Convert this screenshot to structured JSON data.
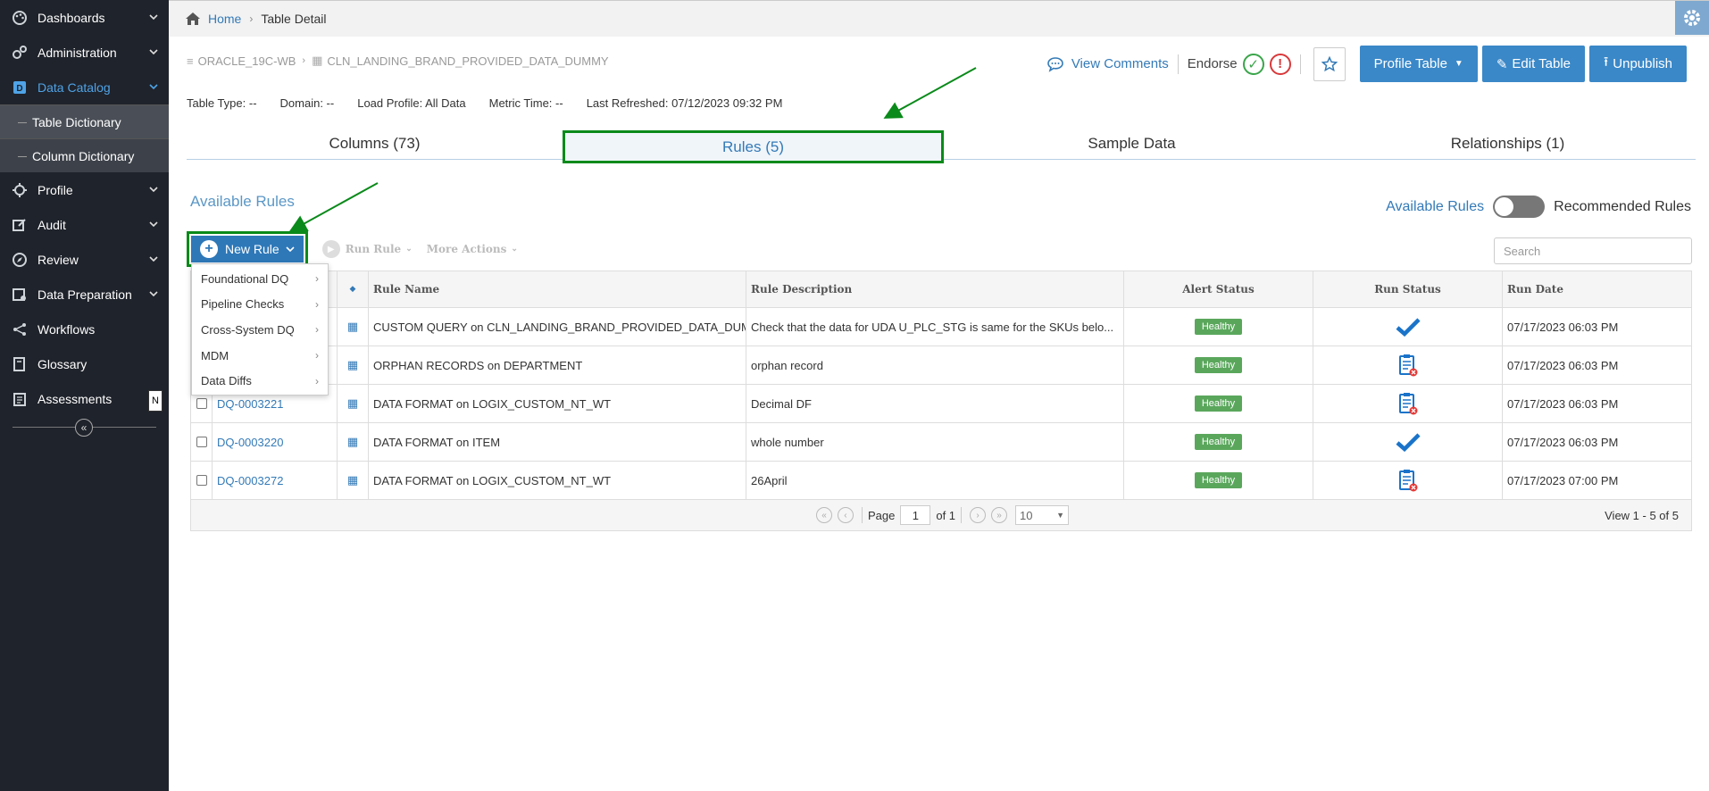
{
  "sidebar": {
    "items": [
      {
        "label": "Dashboards",
        "icon": "palette-icon"
      },
      {
        "label": "Administration",
        "icon": "gears-icon"
      },
      {
        "label": "Data Catalog",
        "icon": "catalog-icon"
      },
      {
        "label": "Profile",
        "icon": "crosshair-icon"
      },
      {
        "label": "Audit",
        "icon": "edit-icon"
      },
      {
        "label": "Review",
        "icon": "compass-icon"
      },
      {
        "label": "Data Preparation",
        "icon": "data-prep-icon"
      },
      {
        "label": "Workflows",
        "icon": "workflow-icon"
      },
      {
        "label": "Glossary",
        "icon": "book-icon"
      },
      {
        "label": "Assessments",
        "icon": "clipboard-icon"
      }
    ],
    "sub_items": [
      "Table Dictionary",
      "Column Dictionary"
    ],
    "tooltip": "N"
  },
  "breadcrumb": {
    "home": "Home",
    "current": "Table Detail"
  },
  "path": {
    "db": "ORACLE_19C-WB",
    "table": "CLN_LANDING_BRAND_PROVIDED_DATA_DUMMY"
  },
  "actions": {
    "view_comments": "View Comments",
    "endorse": "Endorse",
    "profile_table": "Profile Table",
    "edit_table": "Edit Table",
    "unpublish": "Unpublish"
  },
  "meta": {
    "table_type": "Table Type: --",
    "domain": "Domain: --",
    "load_profile": "Load Profile: All Data",
    "metric_time": "Metric Time: --",
    "last_refreshed": "Last Refreshed: 07/12/2023 09:32 PM"
  },
  "tabs": [
    "Columns (73)",
    "Rules (5)",
    "Sample Data",
    "Relationships (1)"
  ],
  "rules": {
    "title": "Available Rules",
    "toggle_left": "Available Rules",
    "toggle_right": "Recommended Rules",
    "new_rule": "New Rule",
    "run_rule": "Run Rule",
    "more_actions": "More Actions",
    "search_placeholder": "Search",
    "dropdown": [
      "Foundational DQ",
      "Pipeline Checks",
      "Cross-System DQ",
      "MDM",
      "Data Diffs"
    ],
    "columns": {
      "name": "Rule Name",
      "desc": "Rule Description",
      "alert": "Alert Status",
      "run": "Run Status",
      "date": "Run Date"
    },
    "rows": [
      {
        "id": "",
        "name": "CUSTOM QUERY on CLN_LANDING_BRAND_PROVIDED_DATA_DUM...",
        "desc": "Check that the data for UDA U_PLC_STG is same for the SKUs belo...",
        "alert": "Healthy",
        "run": "success",
        "date": "07/17/2023 06:03 PM"
      },
      {
        "id": "",
        "name": "ORPHAN RECORDS on DEPARTMENT",
        "desc": "orphan record",
        "alert": "Healthy",
        "run": "failed",
        "date": "07/17/2023 06:03 PM"
      },
      {
        "id": "DQ-0003221",
        "name": "DATA FORMAT on LOGIX_CUSTOM_NT_WT",
        "desc": "Decimal DF",
        "alert": "Healthy",
        "run": "failed",
        "date": "07/17/2023 06:03 PM"
      },
      {
        "id": "DQ-0003220",
        "name": "DATA FORMAT on ITEM",
        "desc": "whole number",
        "alert": "Healthy",
        "run": "success",
        "date": "07/17/2023 06:03 PM"
      },
      {
        "id": "DQ-0003272",
        "name": "DATA FORMAT on LOGIX_CUSTOM_NT_WT",
        "desc": "26April",
        "alert": "Healthy",
        "run": "failed",
        "date": "07/17/2023 07:00 PM"
      }
    ],
    "pager": {
      "page_label": "Page",
      "page": "1",
      "of": "of 1",
      "size": "10",
      "info": "View 1 - 5 of 5"
    }
  }
}
